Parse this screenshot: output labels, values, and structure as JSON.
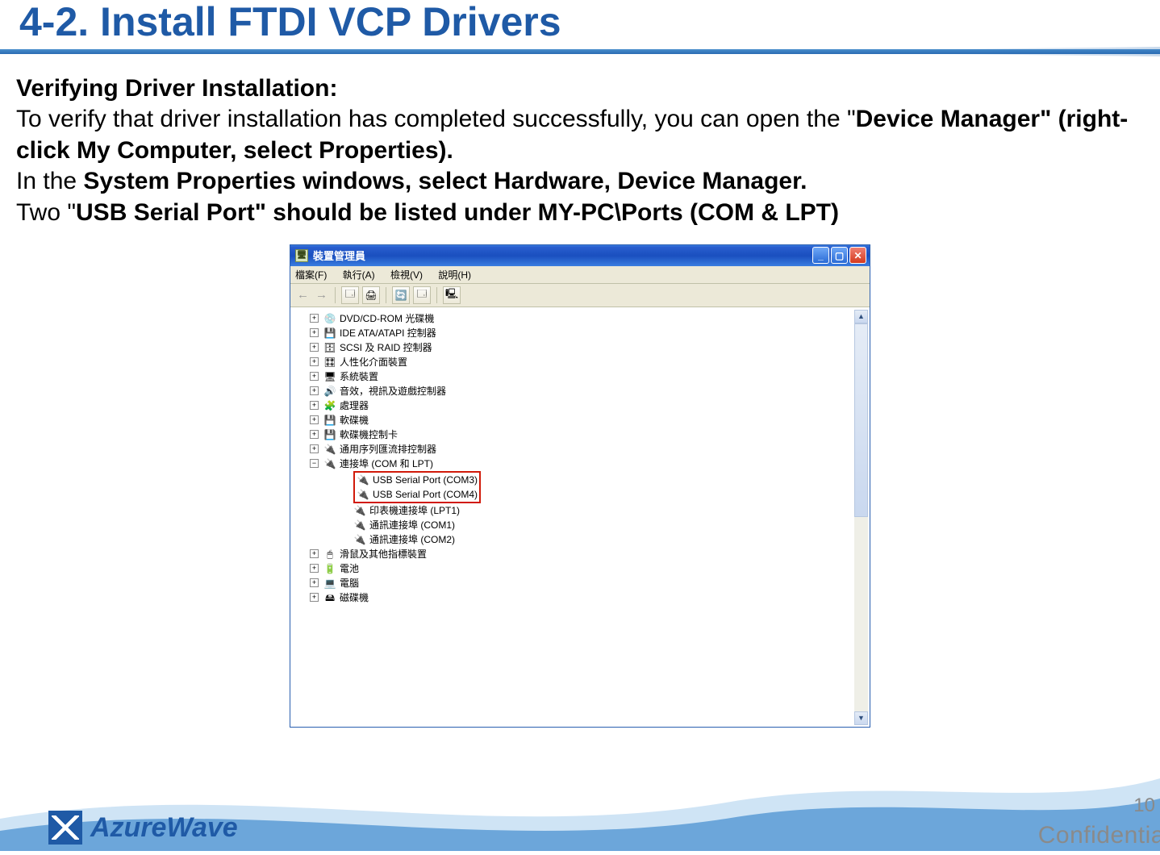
{
  "page": {
    "title": "4-2. Install FTDI VCP Drivers",
    "number": "10",
    "confidential_fragment": "Confidentia"
  },
  "section": {
    "subheading": "Verifying Driver Installation:",
    "p1_prefix": "To verify that driver installation has completed successfully, you can open the \"",
    "p1_bold": "Device Manager\" (right-click My Computer, select Properties).",
    "p2_prefix": "In the ",
    "p2_bold": "System Properties windows, select Hardware, Device Manager.",
    "p3_prefix": "Two \"",
    "p3_bold": "USB Serial Port\" should be listed under MY-PC\\Ports (COM & LPT)"
  },
  "device_manager": {
    "window_title": "裝置管理員",
    "menu": {
      "file": "檔案(F)",
      "action": "執行(A)",
      "view": "檢視(V)",
      "help": "說明(H)"
    },
    "toolbar": {
      "back": "←",
      "forward": "→",
      "props": "properties-icon",
      "print": "print-icon",
      "refresh": "refresh-icon",
      "details": "details-icon",
      "scan": "scan-hardware-icon"
    },
    "tree": {
      "items": [
        {
          "icon": "dvd-drive-icon",
          "label": "DVD/CD-ROM 光碟機",
          "expandable": true,
          "expanded": false
        },
        {
          "icon": "ide-controller-icon",
          "label": "IDE ATA/ATAPI 控制器",
          "expandable": true,
          "expanded": false
        },
        {
          "icon": "scsi-raid-icon",
          "label": "SCSI 及 RAID 控制器",
          "expandable": true,
          "expanded": false
        },
        {
          "icon": "hid-icon",
          "label": "人性化介面裝置",
          "expandable": true,
          "expanded": false
        },
        {
          "icon": "system-device-icon",
          "label": "系統裝置",
          "expandable": true,
          "expanded": false
        },
        {
          "icon": "sound-icon",
          "label": "音效，視訊及遊戲控制器",
          "expandable": true,
          "expanded": false
        },
        {
          "icon": "cpu-icon",
          "label": "處理器",
          "expandable": true,
          "expanded": false
        },
        {
          "icon": "floppy-drive-icon",
          "label": "軟碟機",
          "expandable": true,
          "expanded": false
        },
        {
          "icon": "floppy-controller-icon",
          "label": "軟碟機控制卡",
          "expandable": true,
          "expanded": false
        },
        {
          "icon": "usb-controller-icon",
          "label": "通用序列匯流排控制器",
          "expandable": true,
          "expanded": false
        },
        {
          "icon": "port-icon",
          "label": "連接埠 (COM 和 LPT)",
          "expandable": true,
          "expanded": true,
          "children": [
            {
              "icon": "port-icon",
              "label": "USB Serial Port (COM3)",
              "highlight": true
            },
            {
              "icon": "port-icon",
              "label": "USB Serial Port (COM4)",
              "highlight": true
            },
            {
              "icon": "port-icon",
              "label": "印表機連接埠 (LPT1)"
            },
            {
              "icon": "port-icon",
              "label": "通訊連接埠 (COM1)"
            },
            {
              "icon": "port-icon",
              "label": "通訊連接埠 (COM2)"
            }
          ]
        },
        {
          "icon": "mouse-icon",
          "label": "滑鼠及其他指標裝置",
          "expandable": true,
          "expanded": false
        },
        {
          "icon": "battery-icon",
          "label": "電池",
          "expandable": true,
          "expanded": false
        },
        {
          "icon": "computer-icon",
          "label": "電腦",
          "expandable": true,
          "expanded": false
        },
        {
          "icon": "disk-drive-icon",
          "label": "磁碟機",
          "expandable": true,
          "expanded": false
        }
      ]
    }
  },
  "branding": {
    "company": "AzureWave"
  },
  "colors": {
    "brand_blue": "#1f5aa6",
    "xp_blue": "#2a5fcf",
    "highlight_red": "#d11a0a"
  }
}
